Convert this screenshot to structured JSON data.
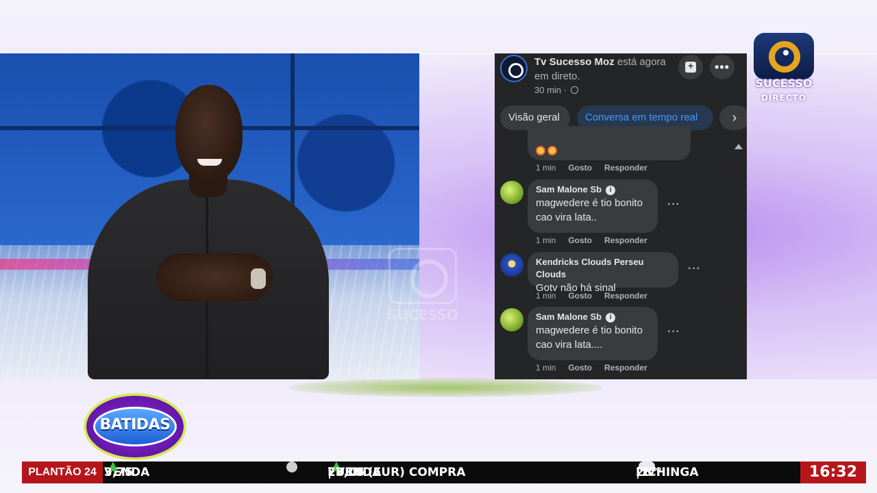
{
  "facebook": {
    "page_name": "Tv Sucesso Moz",
    "status_text": " está agora em direto.",
    "time": "30 min ·",
    "tabs": [
      "Visão geral",
      "Conversa em tempo real"
    ],
    "comments": [
      {
        "name": "",
        "text": "",
        "time": "1 min",
        "like": "Gosto",
        "reply": "Responder"
      },
      {
        "name": "Sam Malone Sb",
        "text_lines": [
          "magwedere é tio bonito",
          "cao vira lata.."
        ],
        "time": "1 min",
        "like": "Gosto",
        "reply": "Responder"
      },
      {
        "name": "Kendricks Clouds Perseu Clouds",
        "text_lines": [
          "Gotv não há sinal"
        ],
        "time": "1 min",
        "like": "Gosto",
        "reply": "Responder"
      },
      {
        "name": "Sam Malone Sb",
        "text_lines": [
          "magwedere é tio bonito",
          "cao vira lata...."
        ],
        "time": "1 min",
        "like": "Gosto",
        "reply": "Responder"
      }
    ]
  },
  "channel_logo": {
    "name": "SUCESSO",
    "subtitle": "DIRECTO",
    "accent_color": "#e5a520"
  },
  "video_watermark": "SUCESSO",
  "program_badge": "BATIDAS",
  "ticker": {
    "tag": "PLANTÃO 24",
    "segment1": "VENDA",
    "value1": "3,75",
    "segment2": "EURO (EUR) COMPRA",
    "value2": "73,06",
    "segment3": "| VENDA",
    "city": "LICHINGA",
    "temp_high": "28°",
    "temp_low": "17°",
    "clock": "16:32",
    "up_color": "#3fc13a",
    "tag_color": "#b6161b"
  },
  "icons": {
    "page_avatar": "tv-sucesso-avatar-icon",
    "save": "save-bookmark-icon",
    "more": "more-options-icon",
    "globe": "globe-icon",
    "next": "chevron-right-icon",
    "weather": "partly-cloudy-icon",
    "trend": "arrow-up-icon"
  }
}
